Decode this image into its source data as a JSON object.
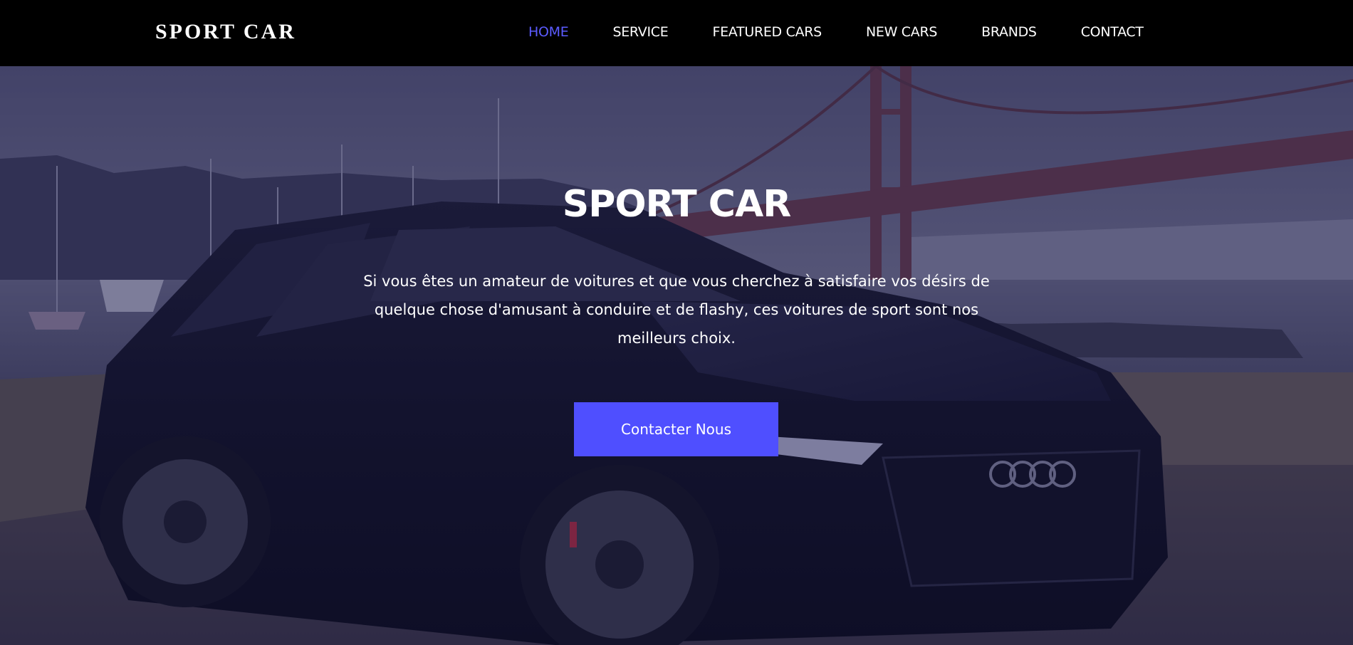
{
  "brand": {
    "name": "SPORT CAR"
  },
  "nav": {
    "items": [
      {
        "label": "HOME",
        "active": true
      },
      {
        "label": "SERVICE",
        "active": false
      },
      {
        "label": "FEATURED CARS",
        "active": false
      },
      {
        "label": "NEW CARS",
        "active": false
      },
      {
        "label": "BRANDS",
        "active": false
      },
      {
        "label": "CONTACT",
        "active": false
      }
    ]
  },
  "hero": {
    "title": "SPORT CAR",
    "text": "Si vous êtes un amateur de voitures et que vous cherchez à satisfaire vos désirs de quelque chose d'amusant à conduire et de flashy, ces voitures de sport sont nos meilleurs choix.",
    "cta_label": "Contacter Nous"
  },
  "colors": {
    "accent": "#4f4fff",
    "nav_active": "#5b5bff",
    "navbar_bg": "#000000",
    "overlay": "#1c1c4e"
  }
}
